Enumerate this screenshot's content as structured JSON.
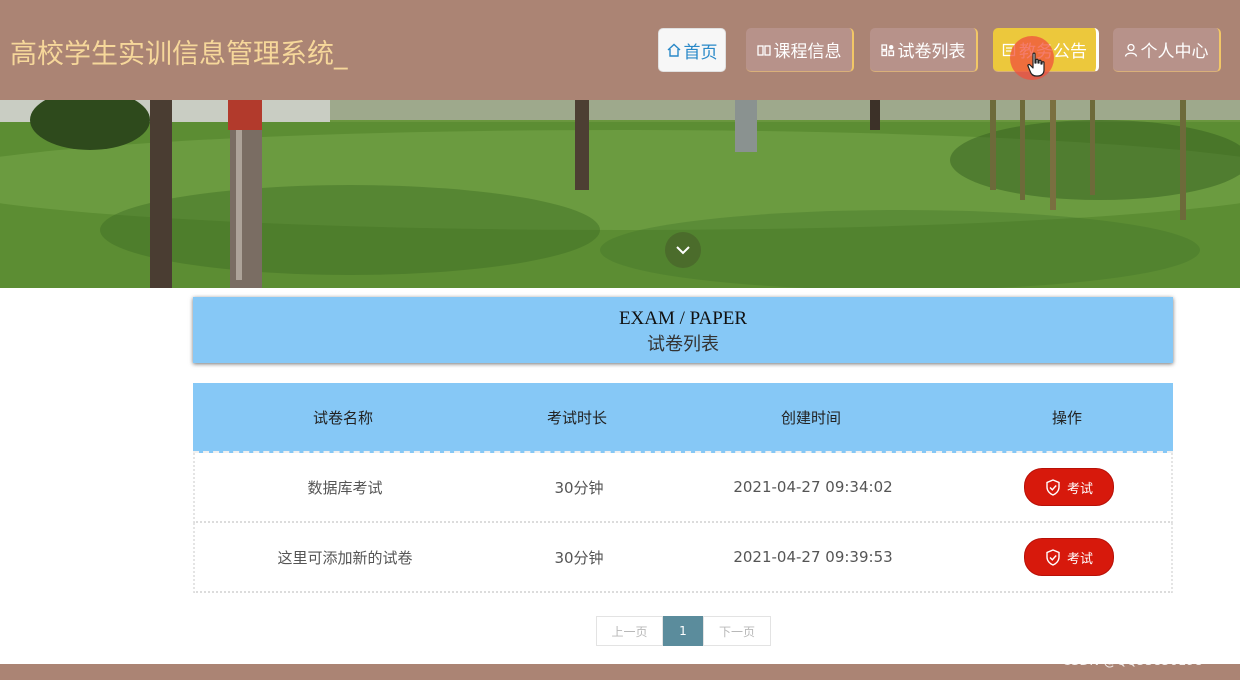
{
  "header": {
    "title": "高校学生实训信息管理系统_",
    "nav": [
      {
        "label": "首页",
        "icon": "home-icon"
      },
      {
        "label": "课程信息",
        "icon": "book-icon"
      },
      {
        "label": "试卷列表",
        "icon": "grid-icon"
      },
      {
        "label": "教务公告",
        "icon": "notice-icon"
      },
      {
        "label": "个人中心",
        "icon": "user-icon"
      }
    ]
  },
  "section": {
    "title_en": "EXAM / PAPER",
    "title_cn": "试卷列表"
  },
  "table": {
    "headers": [
      "试卷名称",
      "考试时长",
      "创建时间",
      "操作"
    ],
    "rows": [
      {
        "name": "数据库考试",
        "duration": "30分钟",
        "created": "2021-04-27 09:34:02",
        "action": "考试"
      },
      {
        "name": "这里可添加新的试卷",
        "duration": "30分钟",
        "created": "2021-04-27 09:39:53",
        "action": "考试"
      }
    ]
  },
  "pagination": {
    "prev": "上一页",
    "current": "1",
    "next": "下一页"
  },
  "watermark": "CSDN @QQ53850198",
  "colors": {
    "header_bg": "#ab8474",
    "title_text": "#f6d79a",
    "active_nav": "#ecc83c",
    "section_bg": "#86c8f6",
    "exam_button": "#d7190c",
    "current_page": "#5b8c9c"
  }
}
